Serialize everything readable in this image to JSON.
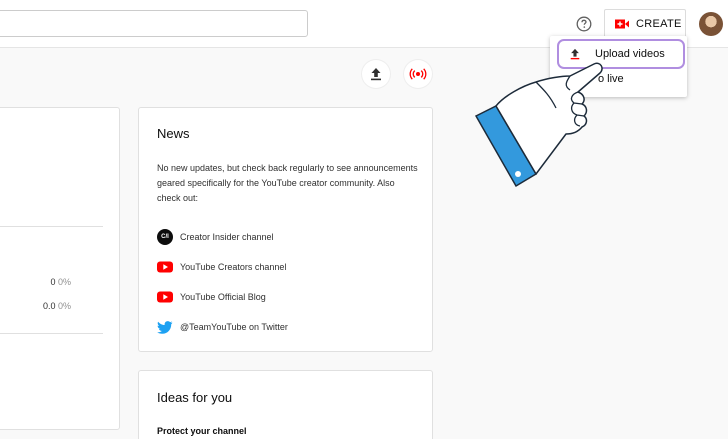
{
  "header": {
    "search_placeholder": "",
    "help_icon": "question-circle-icon",
    "create_label": "CREATE",
    "create_icon": "video-camera-plus-icon"
  },
  "create_menu": {
    "items": [
      {
        "label": "Upload videos",
        "icon": "upload-icon"
      },
      {
        "label": "Go live",
        "visible_label": "o live",
        "icon": "live-icon"
      }
    ]
  },
  "toolbar": {
    "upload_icon": "upload-icon",
    "live_icon": "live-broadcast-icon"
  },
  "left_card": {
    "stats": [
      {
        "value": "0",
        "pct": "0%"
      },
      {
        "value": "0.0",
        "pct": "0%"
      }
    ]
  },
  "news": {
    "title": "News",
    "body": "No new updates, but check back regularly to see announcements geared specifically for the YouTube creator community. Also check out:",
    "links": [
      {
        "label": "Creator Insider channel",
        "icon": "creator-insider-icon",
        "icon_text": "C/I"
      },
      {
        "label": "YouTube Creators channel",
        "icon": "youtube-icon"
      },
      {
        "label": "YouTube Official Blog",
        "icon": "youtube-icon"
      },
      {
        "label": "@TeamYouTube on Twitter",
        "icon": "twitter-icon"
      }
    ]
  },
  "ideas": {
    "title": "Ideas for you",
    "item": "Protect your channel"
  },
  "colors": {
    "youtube_red": "#ff0000",
    "highlight_purple": "#b08ee0",
    "cuff_blue": "#3399dd",
    "twitter_blue": "#1da1f2"
  }
}
